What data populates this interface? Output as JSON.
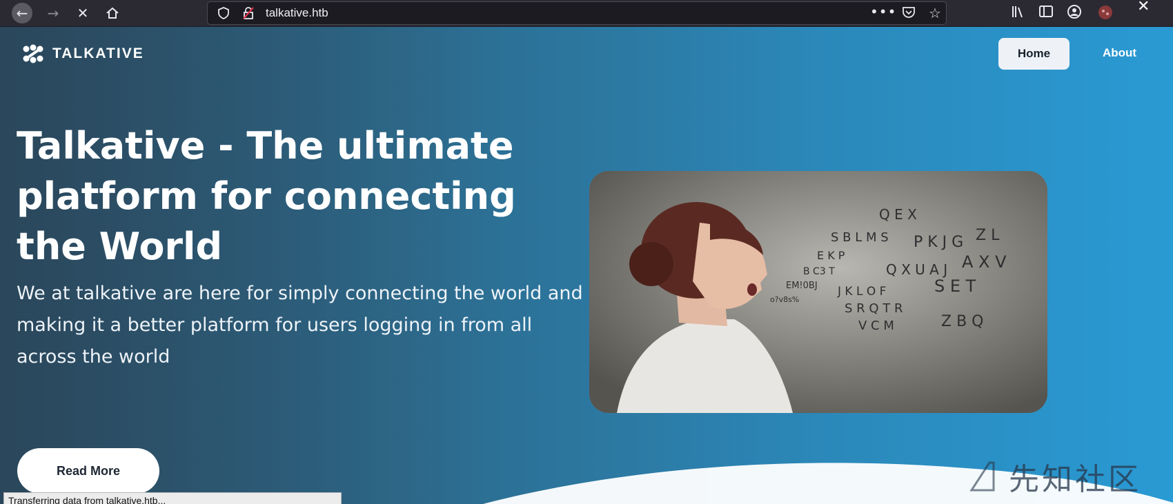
{
  "browser": {
    "url": "talkative.htb",
    "icons": [
      "back-icon",
      "forward-icon",
      "stop-icon",
      "home-icon",
      "shield-icon",
      "insecure-lock-icon",
      "more-icon",
      "pocket-icon",
      "star-icon",
      "library-icon",
      "sidebar-icon",
      "account-icon",
      "extension-icon"
    ]
  },
  "site": {
    "logo_text": "TALKATIVE",
    "nav": {
      "home": "Home",
      "about": "About"
    },
    "hero": {
      "title": "Talkative - The ultimate platform for connecting the World",
      "subtitle": "We at talkative are here for simply connecting the world and making it a better platform for users logging in from all across the world",
      "button": "Read More"
    },
    "colors": {
      "bg_left": "#2c4f66",
      "bg_right": "#2a9ad4",
      "button_bg": "#ffffff",
      "nav_active_bg": "#eef2f6"
    }
  },
  "status_bar": "Transferring data from talkative.htb...",
  "watermark": "先知社区"
}
